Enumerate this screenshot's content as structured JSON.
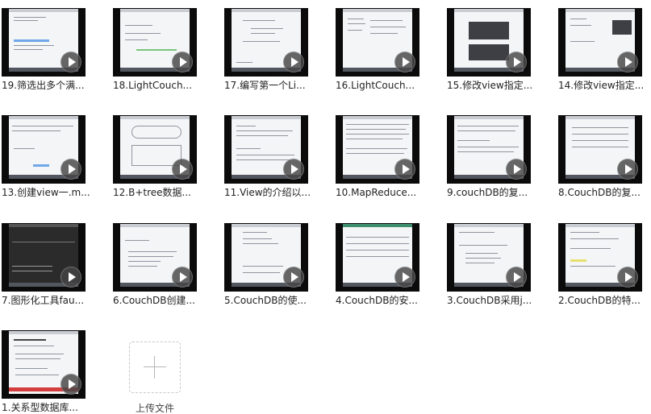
{
  "files": [
    {
      "title": "19.筛选出多个满..."
    },
    {
      "title": "18.LightCouch..."
    },
    {
      "title": "17.编写第一个Li..."
    },
    {
      "title": "16.LightCouch..."
    },
    {
      "title": "15.修改view指定..."
    },
    {
      "title": "14.修改view指定..."
    },
    {
      "title": "13.创建view一.m..."
    },
    {
      "title": "12.B+tree数据..."
    },
    {
      "title": "11.View的介绍以..."
    },
    {
      "title": "10.MapReduce..."
    },
    {
      "title": "9.couchDB的复..."
    },
    {
      "title": "8.CouchDB的复..."
    },
    {
      "title": "7.图形化工具fau..."
    },
    {
      "title": "6.CouchDB创建..."
    },
    {
      "title": "5.CouchDB的使..."
    },
    {
      "title": "4.CouchDB的安..."
    },
    {
      "title": "3.CouchDB采用j..."
    },
    {
      "title": "2.CouchDB的特..."
    },
    {
      "title": "1.关系型数据库..."
    }
  ],
  "upload": {
    "label": "上传文件",
    "icon": "plus-icon"
  },
  "icons": {
    "play": "play-icon"
  }
}
